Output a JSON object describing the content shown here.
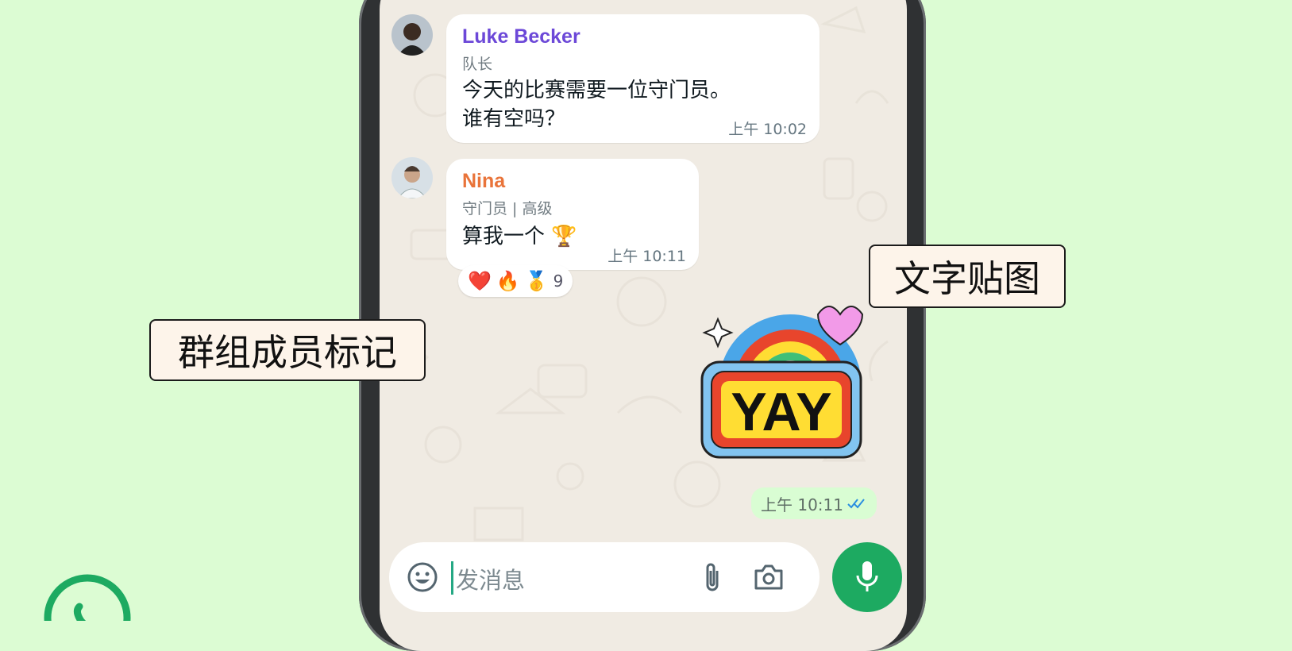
{
  "chat": {
    "messages": [
      {
        "sender": "Luke Becker",
        "sender_color": "#6c48d8",
        "role": "队长",
        "lines": [
          "今天的比赛需要一位守门员。",
          "谁有空吗？"
        ],
        "time": "上午 10:02"
      },
      {
        "sender": "Nina",
        "sender_color": "#e9743a",
        "role": "守门员 | 高级",
        "text": "算我一个 🏆",
        "time": "上午 10:11",
        "reactions": {
          "emojis": [
            "❤️",
            "🔥",
            "🥇"
          ],
          "count": "9"
        }
      }
    ],
    "sticker": {
      "text": "YAY",
      "time": "上午 10:11",
      "status": "read"
    }
  },
  "callouts": {
    "left": "群组成员标记",
    "right": "文字贴图"
  },
  "composer": {
    "placeholder": "发消息"
  },
  "colors": {
    "background": "#dcfcd3",
    "accent": "#1daa61",
    "chat_bg": "#f0ebe3"
  }
}
